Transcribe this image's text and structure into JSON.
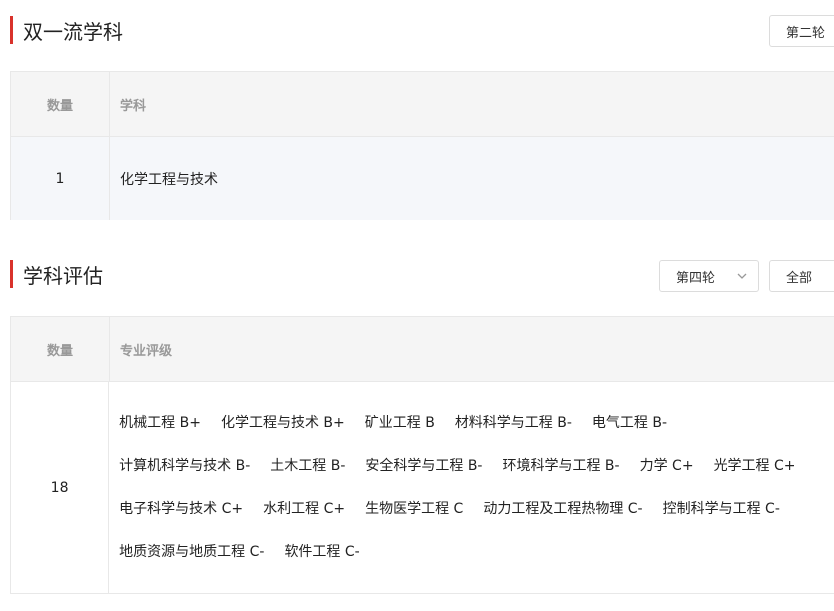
{
  "double_first_class": {
    "title": "双一流学科",
    "round_select": "第二轮",
    "headers": {
      "count": "数量",
      "subject": "学科"
    },
    "row": {
      "count": "1",
      "subject": "化学工程与技术"
    }
  },
  "discipline_evaluation": {
    "title": "学科评估",
    "round_select": "第四轮",
    "filter_select": "全部",
    "headers": {
      "count": "数量",
      "rating": "专业评级"
    },
    "row": {
      "count": "18",
      "items": [
        "机械工程 B+",
        "化学工程与技术 B+",
        "矿业工程 B",
        "材料科学与工程 B-",
        "电气工程 B-",
        "计算机科学与技术 B-",
        "土木工程 B-",
        "安全科学与工程 B-",
        "环境科学与工程 B-",
        "力学 C+",
        "光学工程 C+",
        "电子科学与技术 C+",
        "水利工程 C+",
        "生物医学工程 C",
        "动力工程及工程热物理 C-",
        "控制科学与工程 C-",
        "地质资源与地质工程 C-",
        "软件工程 C-"
      ]
    }
  },
  "colors": {
    "accent": "#d9322b",
    "header_bg": "#f5f5f5",
    "highlight_row_bg": "#f5f7fa",
    "border": "#e8e8e8"
  },
  "icons": {
    "dropdown": "chevron-down-icon"
  }
}
